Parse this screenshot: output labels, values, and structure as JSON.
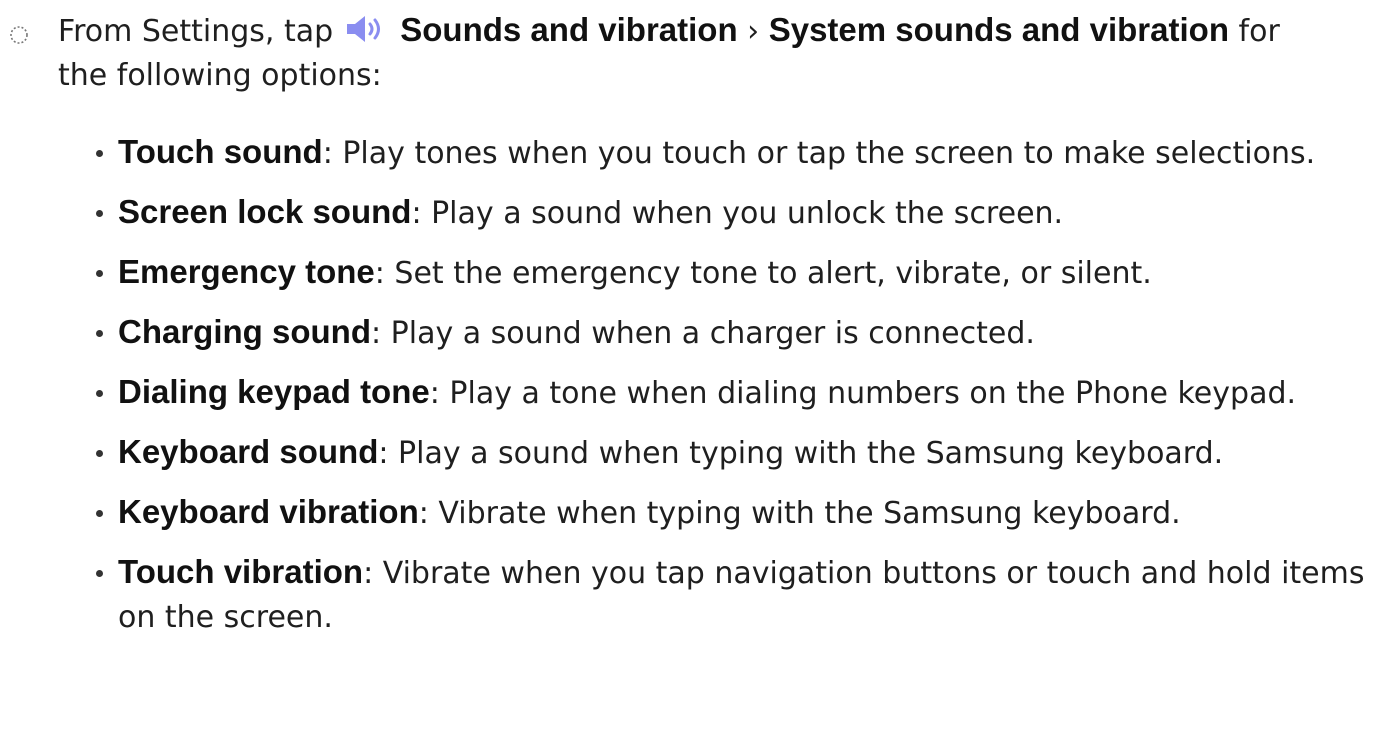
{
  "intro": {
    "prefix": "From Settings, tap",
    "path_item_1": "Sounds and vibration",
    "separator": "›",
    "path_item_2": "System sounds and vibration",
    "suffix": "for",
    "line2": "the following options:",
    "icon": "speaker-icon",
    "icon_color": "#8a8df0"
  },
  "options": [
    {
      "term": "Touch sound",
      "colon": ":",
      "desc": "Play tones when you touch or tap the screen to make selections."
    },
    {
      "term": "Screen lock sound",
      "colon": ":",
      "desc": "Play a sound when you unlock the screen."
    },
    {
      "term": "Emergency tone",
      "colon": ":",
      "desc": "Set the emergency tone to alert, vibrate, or silent."
    },
    {
      "term": "Charging sound",
      "colon": ":",
      "desc": "Play a sound when a charger is connected."
    },
    {
      "term": "Dialing keypad tone",
      "colon": ":",
      "desc": "Play a tone when dialing numbers on the Phone keypad."
    },
    {
      "term": "Keyboard sound",
      "colon": ":",
      "desc": "Play a sound when typing with the Samsung keyboard."
    },
    {
      "term": "Keyboard vibration",
      "colon": ":",
      "desc": "Vibrate when typing with the Samsung keyboard."
    },
    {
      "term": "Touch vibration",
      "colon": ":",
      "desc": "Vibrate when you tap navigation buttons or touch and hold items on the screen."
    }
  ]
}
